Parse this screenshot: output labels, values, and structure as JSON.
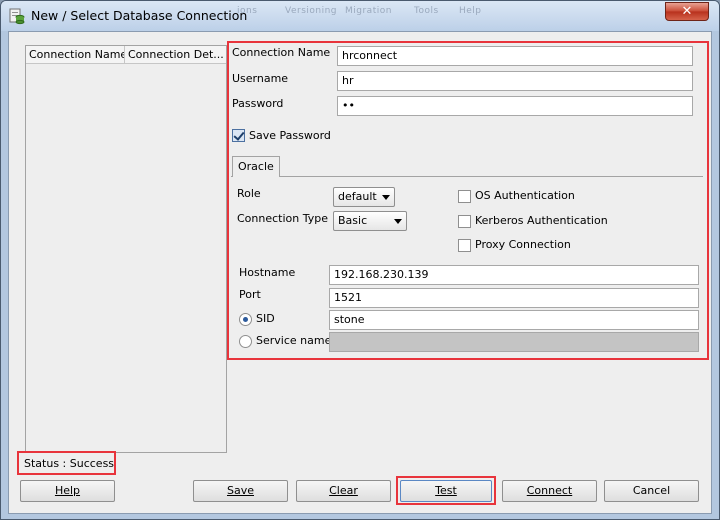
{
  "window": {
    "title": "New / Select Database Connection",
    "close_glyph": "✕",
    "ghost_menu": [
      "ions",
      "Versioning",
      "Migration",
      "Tools",
      "Help"
    ]
  },
  "list": {
    "columns": [
      "Connection Name",
      "Connection Det..."
    ]
  },
  "form": {
    "connection_name": {
      "label": "Connection Name",
      "value": "hrconnect"
    },
    "username": {
      "label": "Username",
      "value": "hr"
    },
    "password": {
      "label": "Password",
      "value": "••"
    },
    "save_password": {
      "label": "Save Password",
      "checked": true
    }
  },
  "tabs": [
    "Oracle"
  ],
  "oracle": {
    "role": {
      "label": "Role",
      "value": "default"
    },
    "connection_type": {
      "label": "Connection Type",
      "value": "Basic"
    },
    "os_auth": {
      "label": "OS Authentication",
      "checked": false
    },
    "kerberos_auth": {
      "label": "Kerberos Authentication",
      "checked": false
    },
    "proxy_connection": {
      "label": "Proxy Connection",
      "checked": false
    },
    "hostname": {
      "label": "Hostname",
      "value": "192.168.230.139"
    },
    "port": {
      "label": "Port",
      "value": "1521"
    },
    "sid": {
      "label": "SID",
      "value": "stone",
      "selected": true
    },
    "service_name": {
      "label": "Service name",
      "value": "",
      "selected": false
    }
  },
  "status": {
    "text": "Status : Success"
  },
  "buttons": {
    "help": "Help",
    "save": "Save",
    "clear": "Clear",
    "test": "Test",
    "connect": "Connect",
    "cancel": "Cancel"
  },
  "colors": {
    "highlight": "#e8343c",
    "window_frame": "#b3c7df",
    "dialog_bg": "#eeeeee"
  }
}
